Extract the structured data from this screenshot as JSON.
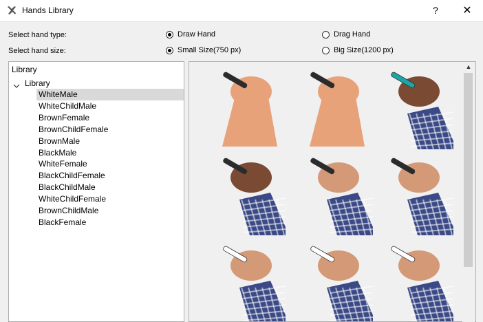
{
  "window": {
    "title": "Hands Library",
    "help_label": "?",
    "close_label": "✕"
  },
  "options": {
    "hand_type_label": "Select hand type:",
    "hand_size_label": "Select hand size:",
    "draw_hand": "Draw Hand",
    "drag_hand": "Drag Hand",
    "small_size": "Small Size(750 px)",
    "big_size": "Big Size(1200 px)",
    "selected_type": "Draw Hand",
    "selected_size": "Small Size(750 px)"
  },
  "tree": {
    "root": "Library",
    "folder": "Library",
    "items": [
      "WhiteMale",
      "WhiteChildMale",
      "BrownFemale",
      "BrownChildFemale",
      "BrownMale",
      "BlackMale",
      "WhiteFemale",
      "BlackChildFemale",
      "BlackChildMale",
      "WhiteChildFemale",
      "BrownChildMale",
      "BlackFemale"
    ],
    "selected": "WhiteMale"
  },
  "gallery": {
    "thumbnails": [
      {
        "name": "hand-thumbnail-1",
        "skin": "#e8a27a",
        "sleeve": "none",
        "marker": "#2b2b2b"
      },
      {
        "name": "hand-thumbnail-2",
        "skin": "#e8a27a",
        "sleeve": "none",
        "marker": "#2b2b2b"
      },
      {
        "name": "hand-thumbnail-3",
        "skin": "#7a4a33",
        "sleeve": "#3b4a86",
        "marker": "#1aa6a6"
      },
      {
        "name": "hand-thumbnail-4",
        "skin": "#7a4a33",
        "sleeve": "#3b4a86",
        "marker": "#2b2b2b"
      },
      {
        "name": "hand-thumbnail-5",
        "skin": "#d49a78",
        "sleeve": "#3b4a86",
        "marker": "#2b2b2b"
      },
      {
        "name": "hand-thumbnail-6",
        "skin": "#d49a78",
        "sleeve": "#3b4a86",
        "marker": "#2b2b2b"
      },
      {
        "name": "hand-thumbnail-7",
        "skin": "#d49a78",
        "sleeve": "#3b4a86",
        "marker": "#ffffff"
      },
      {
        "name": "hand-thumbnail-8",
        "skin": "#d49a78",
        "sleeve": "#3b4a86",
        "marker": "#ffffff"
      },
      {
        "name": "hand-thumbnail-9",
        "skin": "#d49a78",
        "sleeve": "#3b4a86",
        "marker": "#ffffff"
      }
    ]
  }
}
